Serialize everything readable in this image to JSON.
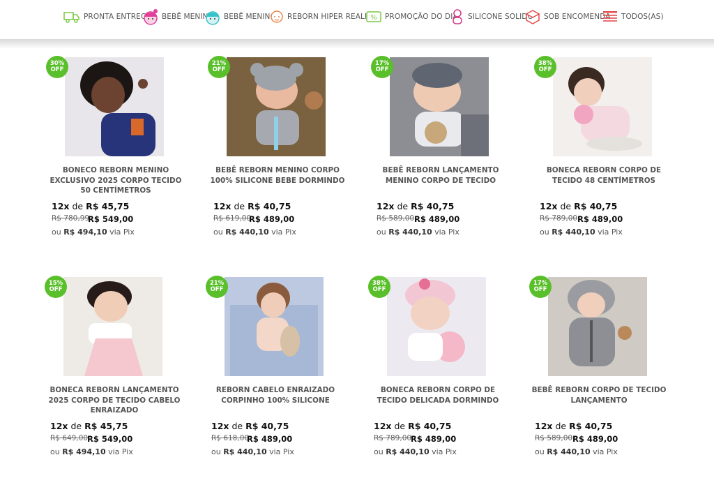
{
  "nav": [
    {
      "label": "PRONTA ENTREGA",
      "icon": "truck-icon"
    },
    {
      "label": "BEBÊ MENINA",
      "icon": "baby-girl-icon"
    },
    {
      "label": "BEBÊ MENINO",
      "icon": "baby-boy-icon"
    },
    {
      "label": "REBORN HIPER REALISTA",
      "icon": "baby-face-icon"
    },
    {
      "label": "PROMOÇÃO DO DIA",
      "icon": "percent-tag-icon"
    },
    {
      "label": "SILICONE SOLIDO",
      "icon": "baby-doll-icon"
    },
    {
      "label": "SOB ENCOMENDA",
      "icon": "box-icon"
    },
    {
      "label": "TODOS(AS)",
      "icon": "list-icon"
    }
  ],
  "products": [
    {
      "discount": "30%",
      "off": "OFF",
      "title": "BONECO REBORN MENINO EXCLUSIVO 2025 CORPO TECIDO 50 CENTÍMETROS",
      "inst_count": "12x",
      "inst_de": "de",
      "inst_value": "R$ 45,75",
      "old_price": "R$ 780,99",
      "price": "R$ 549,00",
      "pix_prefix": "ou",
      "pix_value": "R$ 494,10",
      "pix_suffix": "via Pix"
    },
    {
      "discount": "21%",
      "off": "OFF",
      "title": "BEBÊ REBORN MENINO CORPO 100% SILICONE BEBE DORMINDO",
      "inst_count": "12x",
      "inst_de": "de",
      "inst_value": "R$ 40,75",
      "old_price": "R$ 619,00",
      "price": "R$ 489,00",
      "pix_prefix": "ou",
      "pix_value": "R$ 440,10",
      "pix_suffix": "via Pix"
    },
    {
      "discount": "17%",
      "off": "OFF",
      "title": "BEBÊ REBORN LANÇAMENTO MENINO CORPO DE TECIDO",
      "inst_count": "12x",
      "inst_de": "de",
      "inst_value": "R$ 40,75",
      "old_price": "R$ 589,00",
      "price": "R$ 489,00",
      "pix_prefix": "ou",
      "pix_value": "R$ 440,10",
      "pix_suffix": "via Pix"
    },
    {
      "discount": "38%",
      "off": "OFF",
      "title": "BONECA REBORN CORPO DE TECIDO 48 CENTÍMETROS",
      "inst_count": "12x",
      "inst_de": "de",
      "inst_value": "R$ 40,75",
      "old_price": "R$ 789,00",
      "price": "R$ 489,00",
      "pix_prefix": "ou",
      "pix_value": "R$ 440,10",
      "pix_suffix": "via Pix"
    },
    {
      "discount": "15%",
      "off": "OFF",
      "title": "BONECA REBORN LANÇAMENTO 2025 CORPO DE TECIDO CABELO ENRAIZADO",
      "inst_count": "12x",
      "inst_de": "de",
      "inst_value": "R$ 45,75",
      "old_price": "R$ 649,00",
      "price": "R$ 549,00",
      "pix_prefix": "ou",
      "pix_value": "R$ 494,10",
      "pix_suffix": "via Pix"
    },
    {
      "discount": "21%",
      "off": "OFF",
      "title": "REBORN CABELO ENRAIZADO CORPINHO 100% SILICONE",
      "inst_count": "12x",
      "inst_de": "de",
      "inst_value": "R$ 40,75",
      "old_price": "R$ 618,00",
      "price": "R$ 489,00",
      "pix_prefix": "ou",
      "pix_value": "R$ 440,10",
      "pix_suffix": "via Pix"
    },
    {
      "discount": "38%",
      "off": "OFF",
      "title": "BONECA REBORN CORPO DE TECIDO DELICADA DORMINDO",
      "inst_count": "12x",
      "inst_de": "de",
      "inst_value": "R$ 40,75",
      "old_price": "R$ 789,00",
      "price": "R$ 489,00",
      "pix_prefix": "ou",
      "pix_value": "R$ 440,10",
      "pix_suffix": "via Pix"
    },
    {
      "discount": "17%",
      "off": "OFF",
      "title": "BEBÊ REBORN CORPO DE TECIDO LANÇAMENTO",
      "inst_count": "12x",
      "inst_de": "de",
      "inst_value": "R$ 40,75",
      "old_price": "R$ 589,00",
      "price": "R$ 489,00",
      "pix_prefix": "ou",
      "pix_value": "R$ 440,10",
      "pix_suffix": "via Pix"
    }
  ],
  "colors": {
    "badge": "#59bf2a",
    "nav_green": "#7ac943",
    "nav_pink": "#e0409a",
    "nav_cyan": "#35c3c9",
    "nav_red": "#e34d4d"
  }
}
